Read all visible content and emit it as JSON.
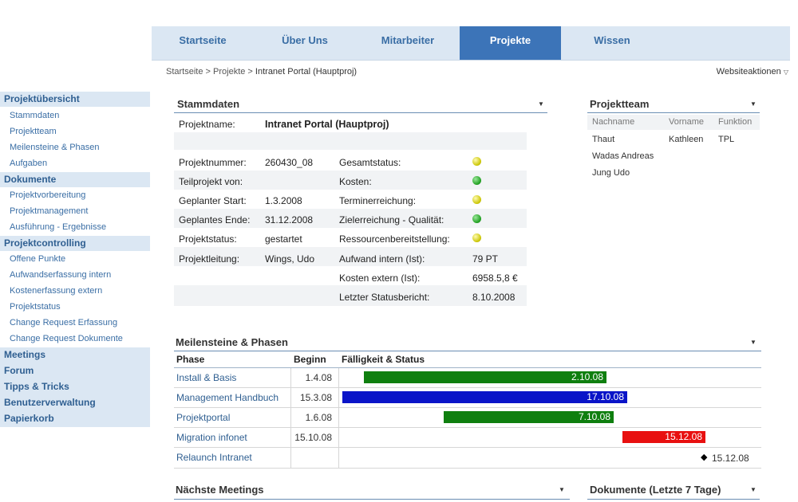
{
  "topnav": {
    "tabs": [
      "Startseite",
      "Über Uns",
      "Mitarbeiter",
      "Projekte",
      "Wissen"
    ],
    "active": "Projekte"
  },
  "breadcrumb": {
    "part1": "Startseite",
    "sep": " > ",
    "part2": "Projekte",
    "current": "Intranet Portal (Hauptproj)"
  },
  "site_actions": {
    "label": "Websiteaktionen",
    "icon": "chevron-down-icon"
  },
  "sidebar": {
    "groups": [
      {
        "label": "Projektübersicht",
        "items": [
          "Stammdaten",
          "Projektteam",
          "Meilensteine & Phasen",
          "Aufgaben"
        ]
      },
      {
        "label": "Dokumente",
        "items": [
          "Projektvorbereitung",
          "Projektmanagement",
          "Ausführung - Ergebnisse"
        ]
      },
      {
        "label": "Projektcontrolling",
        "items": [
          "Offene Punkte",
          "Aufwandserfassung intern",
          "Kostenerfassung extern",
          "Projektstatus",
          "Change Request Erfassung",
          "Change Request Dokumente"
        ]
      },
      {
        "label": "Meetings",
        "items": []
      },
      {
        "label": "Forum",
        "items": []
      },
      {
        "label": "Tipps & Tricks",
        "items": []
      },
      {
        "label": "Benutzerverwaltung",
        "items": []
      },
      {
        "label": "Papierkorb",
        "items": []
      }
    ]
  },
  "stammdaten": {
    "title": "Stammdaten",
    "projektname_label": "Projektname:",
    "projektname_value": "Intranet Portal (Hauptproj)",
    "left": [
      {
        "label": "Projektnummer:",
        "value": "260430_08"
      },
      {
        "label": "Teilprojekt von:",
        "value": ""
      },
      {
        "label": "Geplanter Start:",
        "value": "1.3.2008"
      },
      {
        "label": "Geplantes Ende:",
        "value": "31.12.2008"
      },
      {
        "label": "Projektstatus:",
        "value": "gestartet"
      },
      {
        "label": "Projektleitung:",
        "value": "Wings, Udo"
      }
    ],
    "right": [
      {
        "label": "Gesamtstatus:",
        "status": "yellow"
      },
      {
        "label": "Kosten:",
        "status": "green"
      },
      {
        "label": "Terminerreichung:",
        "status": "yellow"
      },
      {
        "label": "Zielerreichung - Qualität:",
        "status": "green"
      },
      {
        "label": "Ressourcenbereitstellung:",
        "status": "yellow"
      },
      {
        "label": "Aufwand intern (Ist):",
        "value": "79 PT"
      },
      {
        "label": "Kosten extern (Ist):",
        "value": "6958.5,8 €"
      },
      {
        "label": "Letzter Statusbericht:",
        "value": "8.10.2008"
      }
    ],
    "status_colors": {
      "yellow": "#d6cf00",
      "green": "#1e9e1e"
    }
  },
  "projektteam": {
    "title": "Projektteam",
    "columns": [
      "Nachname",
      "Vorname",
      "Funktion"
    ],
    "rows": [
      [
        "Thaut",
        "Kathleen",
        "TPL"
      ],
      [
        "Wadas Andreas",
        "",
        ""
      ],
      [
        "Jung Udo",
        "",
        ""
      ]
    ]
  },
  "meilensteine": {
    "title": "Meilensteine & Phasen",
    "columns": [
      "Phase",
      "Beginn",
      "Fälligkeit & Status"
    ],
    "rows": [
      {
        "phase": "Install & Basis",
        "begin": "1.4.08",
        "due": "2.10.08",
        "color": "#0f7f0f",
        "type": "bar"
      },
      {
        "phase": "Management Handbuch",
        "begin": "15.3.08",
        "due": "17.10.08",
        "color": "#0a14c8",
        "type": "bar"
      },
      {
        "phase": "Projektportal",
        "begin": "1.6.08",
        "due": "7.10.08",
        "color": "#0f7f0f",
        "type": "bar"
      },
      {
        "phase": "Migration infonet",
        "begin": "15.10.08",
        "due": "15.12.08",
        "color": "#e81010",
        "type": "bar"
      },
      {
        "phase": "Relaunch Intranet",
        "begin": "",
        "due": "15.12.08",
        "color": "#000000",
        "type": "milestone"
      }
    ]
  },
  "naechste_meetings": {
    "title": "Nächste Meetings"
  },
  "dokumente": {
    "title": "Dokumente (Letzte 7 Tage)"
  }
}
